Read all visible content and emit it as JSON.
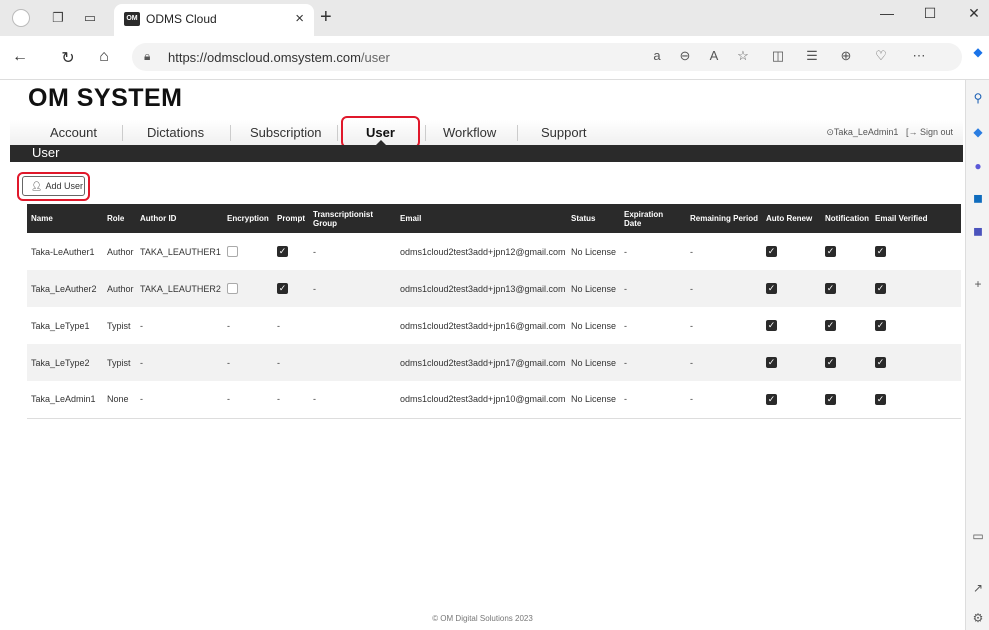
{
  "browser": {
    "tab_title": "ODMS Cloud",
    "tab_favicon": "OM",
    "tab_close": "×",
    "new_tab": "+",
    "url_host": "https://odmscloud.omsystem.com",
    "url_path": "/user",
    "window_controls": [
      "—",
      "☐",
      "✕"
    ]
  },
  "page": {
    "logo": "OM SYSTEM",
    "nav": [
      "Account",
      "Dictations",
      "Subscription",
      "User",
      "Workflow",
      "Support"
    ],
    "active_nav": "User",
    "user_name": "Taka_LeAdmin1",
    "sign_out": "Sign out",
    "section_title": "User",
    "add_user_label": "Add User",
    "footer": "© OM Digital Solutions 2023"
  },
  "table": {
    "headers": [
      "Name",
      "Role",
      "Author ID",
      "Encryption",
      "Prompt",
      "Transcriptionist Group",
      "Email",
      "Status",
      "Expiration Date",
      "Remaining Period",
      "Auto Renew",
      "Notification",
      "Email Verified"
    ],
    "rows": [
      {
        "name": "Taka-LeAuther1",
        "role": "Author",
        "author_id": "TAKA_LEAUTHER1",
        "encryption": "off",
        "prompt": "on",
        "group": "-",
        "email": "odms1cloud2test3add+jpn12@gmail.com",
        "status": "No License",
        "expiration": "-",
        "remaining": "-",
        "auto_renew": "on",
        "notification": "on",
        "email_verified": "on"
      },
      {
        "name": "Taka_LeAuther2",
        "role": "Author",
        "author_id": "TAKA_LEAUTHER2",
        "encryption": "off",
        "prompt": "on",
        "group": "-",
        "email": "odms1cloud2test3add+jpn13@gmail.com",
        "status": "No License",
        "expiration": "-",
        "remaining": "-",
        "auto_renew": "on",
        "notification": "on",
        "email_verified": "on"
      },
      {
        "name": "Taka_LeType1",
        "role": "Typist",
        "author_id": "-",
        "encryption": "-",
        "prompt": "-",
        "group": "",
        "email": "odms1cloud2test3add+jpn16@gmail.com",
        "status": "No License",
        "expiration": "-",
        "remaining": "-",
        "auto_renew": "on",
        "notification": "on",
        "email_verified": "on"
      },
      {
        "name": "Taka_LeType2",
        "role": "Typist",
        "author_id": "-",
        "encryption": "-",
        "prompt": "-",
        "group": "",
        "email": "odms1cloud2test3add+jpn17@gmail.com",
        "status": "No License",
        "expiration": "-",
        "remaining": "-",
        "auto_renew": "on",
        "notification": "on",
        "email_verified": "on"
      },
      {
        "name": "Taka_LeAdmin1",
        "role": "None",
        "author_id": "-",
        "encryption": "-",
        "prompt": "-",
        "group": "-",
        "email": "odms1cloud2test3add+jpn10@gmail.com",
        "status": "No License",
        "expiration": "-",
        "remaining": "-",
        "auto_renew": "on",
        "notification": "on",
        "email_verified": "on"
      }
    ]
  },
  "colors": {
    "accent_red": "#e0182b",
    "status_red": "#e2401f",
    "header_dark": "#2a2a2a"
  }
}
